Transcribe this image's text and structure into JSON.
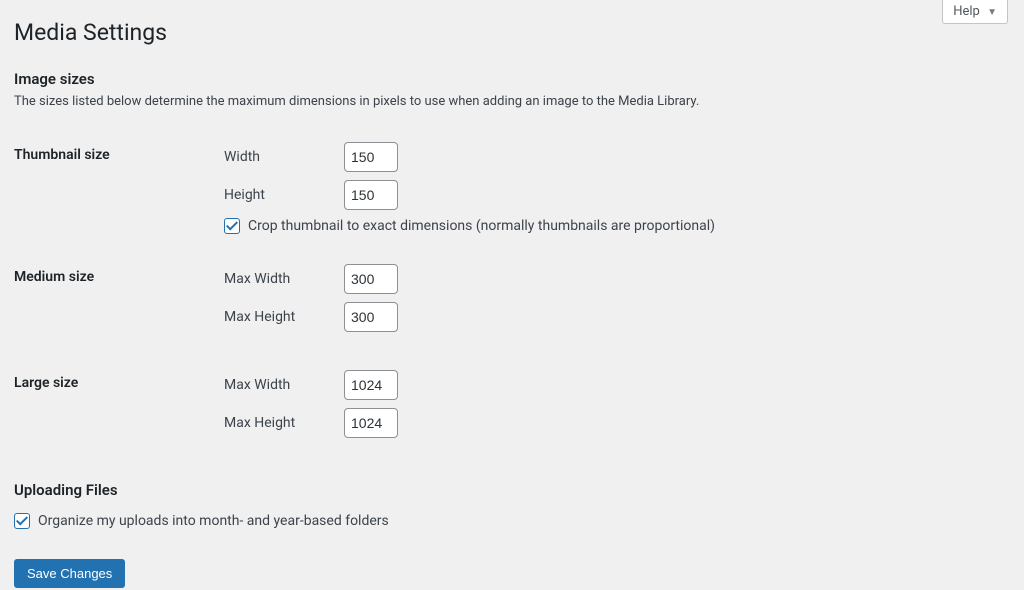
{
  "help": {
    "label": "Help"
  },
  "page": {
    "title": "Media Settings"
  },
  "image_sizes": {
    "heading": "Image sizes",
    "description": "The sizes listed below determine the maximum dimensions in pixels to use when adding an image to the Media Library.",
    "thumbnail": {
      "label": "Thumbnail size",
      "width_label": "Width",
      "width_value": "150",
      "height_label": "Height",
      "height_value": "150",
      "crop_label": "Crop thumbnail to exact dimensions (normally thumbnails are proportional)",
      "crop_checked": true
    },
    "medium": {
      "label": "Medium size",
      "max_width_label": "Max Width",
      "max_width_value": "300",
      "max_height_label": "Max Height",
      "max_height_value": "300"
    },
    "large": {
      "label": "Large size",
      "max_width_label": "Max Width",
      "max_width_value": "1024",
      "max_height_label": "Max Height",
      "max_height_value": "1024"
    }
  },
  "uploading_files": {
    "heading": "Uploading Files",
    "organize_label": "Organize my uploads into month- and year-based folders",
    "organize_checked": true
  },
  "submit": {
    "label": "Save Changes"
  }
}
